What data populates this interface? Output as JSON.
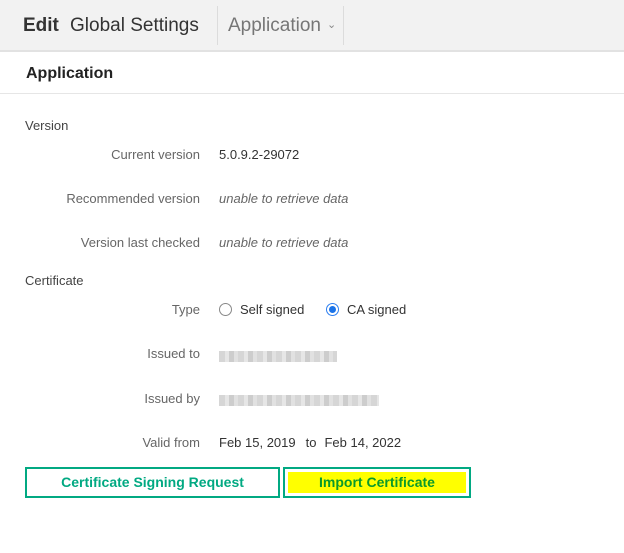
{
  "header": {
    "edit_label": "Edit",
    "title": "Global Settings",
    "section_dropdown": {
      "selected": "Application",
      "icon": "chevron-down-icon"
    }
  },
  "section": {
    "title": "Application"
  },
  "version": {
    "group_label": "Version",
    "rows": [
      {
        "label": "Current version",
        "value": "5.0.9.2-29072"
      },
      {
        "label": "Recommended version",
        "value": "unable to retrieve data"
      },
      {
        "label": "Version last checked",
        "value": "unable to retrieve data"
      }
    ]
  },
  "certificate": {
    "group_label": "Certificate",
    "type": {
      "label": "Type",
      "options": [
        {
          "label": "Self signed",
          "checked": false
        },
        {
          "label": "CA signed",
          "checked": true
        }
      ]
    },
    "issued_to": {
      "label": "Issued to",
      "value": "[redacted]"
    },
    "issued_by": {
      "label": "Issued by",
      "value": "[redacted]"
    },
    "valid": {
      "label": "Valid from",
      "from": "Feb 15, 2019",
      "to_label": "to",
      "to": "Feb 14, 2022"
    }
  },
  "buttons": {
    "csr": "Certificate Signing Request",
    "import": "Import Certificate"
  },
  "colors": {
    "accent": "#01a982",
    "highlight": "#ffff00",
    "radio_checked": "#1a73e8"
  }
}
